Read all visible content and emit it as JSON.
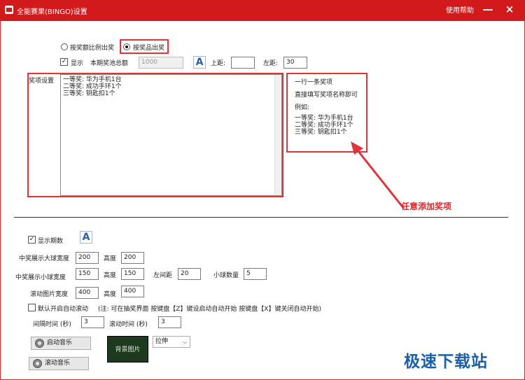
{
  "titlebar": {
    "title": "全能赛果(BINGO)设置",
    "help": "使用帮助",
    "minimize": "—",
    "close": "×"
  },
  "mode": {
    "option_ratio": "按奖额比例出奖",
    "option_item": "按奖品出奖",
    "selected": "option_item"
  },
  "row2": {
    "show_label": "显示",
    "show_checked": true,
    "pool_label": "本期奖池总额",
    "pool_value": "1000",
    "top_label": "上距:",
    "top_value": "",
    "left_label": "左距:",
    "left_value": "30"
  },
  "prizes": {
    "label": "奖项设置",
    "text": "一等奖: 华为手机1台\n二等奖: 成功手环1个\n三等奖: 钥匙扣1个"
  },
  "hint": {
    "line1": "一行一条奖项",
    "line2": "直接填写奖项名称即可",
    "line3": "例如:",
    "example": "一等奖: 华为手机1台\n二等奖: 成功手环1个\n三等奖: 钥匙扣1个",
    "annotation": "任意添加奖项"
  },
  "lower": {
    "show_period_label": "显示期数",
    "show_period_checked": true,
    "big_ball_label": "中奖展示大球宽度",
    "big_ball_width": "200",
    "big_ball_height_label": "高度",
    "big_ball_height": "200",
    "small_ball_label": "中奖展示小球宽度",
    "small_ball_width": "150",
    "small_ball_height_label": "高度",
    "small_ball_height": "150",
    "left_gap_label": "左间距",
    "left_gap": "20",
    "small_count_label": "小球数量",
    "small_count": "5",
    "scroll_img_label": "滚动图片宽度",
    "scroll_img_width": "400",
    "scroll_img_height_label": "高度",
    "scroll_img_height": "400",
    "auto_scroll_label": "默认开启自动滚动",
    "auto_scroll_checked": false,
    "auto_scroll_note": "(注: 可在抽奖界面 按键盘【Z】键设启动自动开始    按键盘【X】键关闭自动开始)",
    "interval_label": "间隔时间 (秒)",
    "interval_value": "3",
    "scroll_time_label": "滚动时间 (秒)",
    "scroll_time_value": "3",
    "start_music": "启动音乐",
    "scroll_music": "滚动音乐",
    "bg_image": "背景图片",
    "stretch_option": "拉伸"
  },
  "watermark": "极速下载站",
  "colors": {
    "titlebar": "#d2191c",
    "highlight": "#e1333a",
    "watermark": "#1b5fa8"
  }
}
